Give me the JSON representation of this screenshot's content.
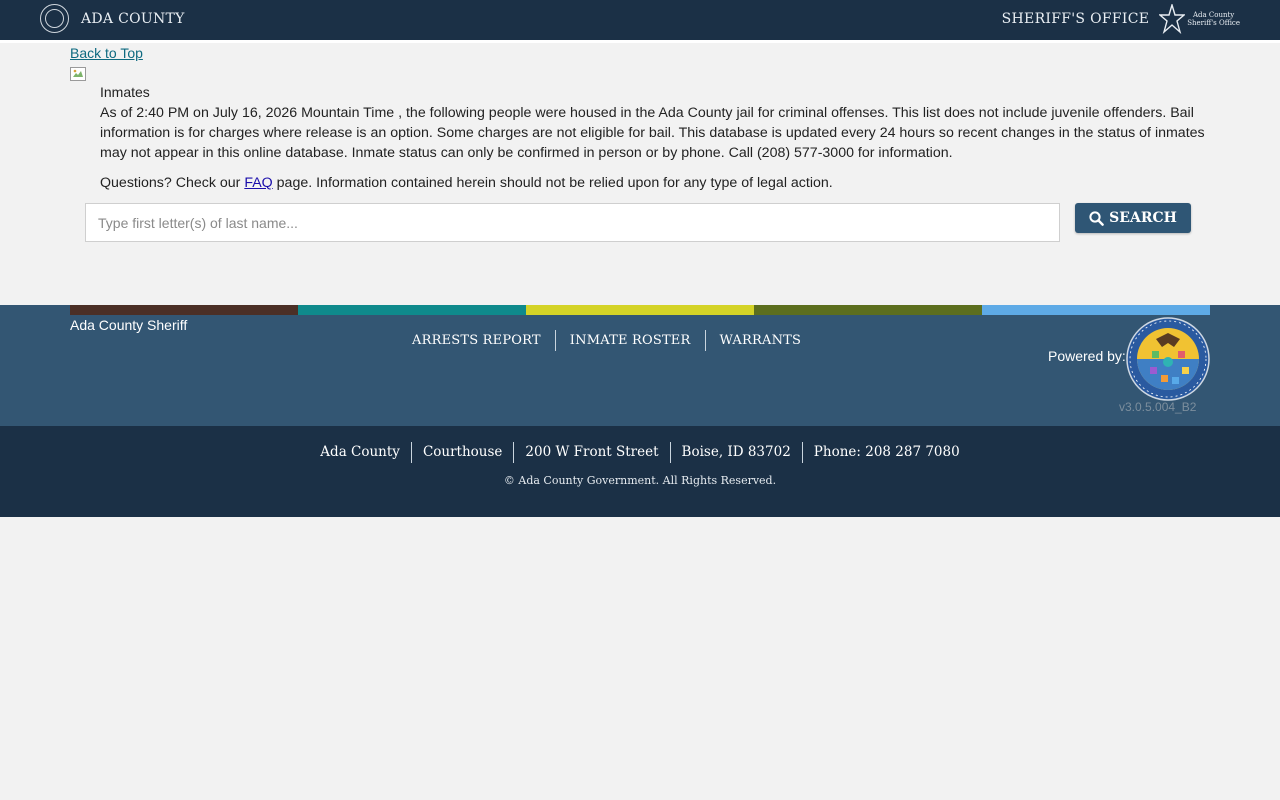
{
  "header": {
    "left_title": "ADA COUNTY",
    "right_title": "SHERIFF'S OFFICE",
    "right_logo_text_line1": "Ada County",
    "right_logo_text_line2": "Sheriff's Office",
    "seal_icon": "county-seal-icon",
    "star_icon": "sheriff-star-icon"
  },
  "content": {
    "back_to_top": "Back to Top",
    "section_title": "Inmates",
    "intro": "As of 2:40 PM on July 16, 2026 Mountain Time , the following people were housed in the Ada County jail for criminal offenses. This list does not include juvenile offenders. Bail information is for charges where release is an option. Some charges are not eligible for bail. This database is updated every 24 hours so recent changes in the status of inmates may not appear in this online database. Inmate status can only be confirmed in person or by phone. Call (208) 577-3000 for information.",
    "questions_before": "Questions? Check our ",
    "faq_link": "FAQ",
    "questions_after": " page. Information contained herein should not be relied upon for any type of legal action."
  },
  "search": {
    "placeholder": "Type first letter(s) of last name...",
    "value": "",
    "button_label": "SEARCH"
  },
  "footer": {
    "title": "Ada County Sheriff",
    "nav": [
      "ARRESTS REPORT",
      "INMATE ROSTER",
      "WARRANTS"
    ],
    "powered_by": "Powered by:",
    "version": "v3.0.5.004_B2",
    "color_bar": [
      "#4b2f26",
      "#0f8a8c",
      "#d4d327",
      "#5c6e1e",
      "#5eaae6"
    ],
    "address": [
      "Ada County",
      "Courthouse",
      "200 W Front Street",
      "Boise, ID 83702",
      "Phone: 208 287 7080"
    ],
    "copyright": "© Ada County Government. All Rights Reserved.",
    "it_logo_text": "ADA COUNTY INFORMATION TECHNOLOGY"
  }
}
